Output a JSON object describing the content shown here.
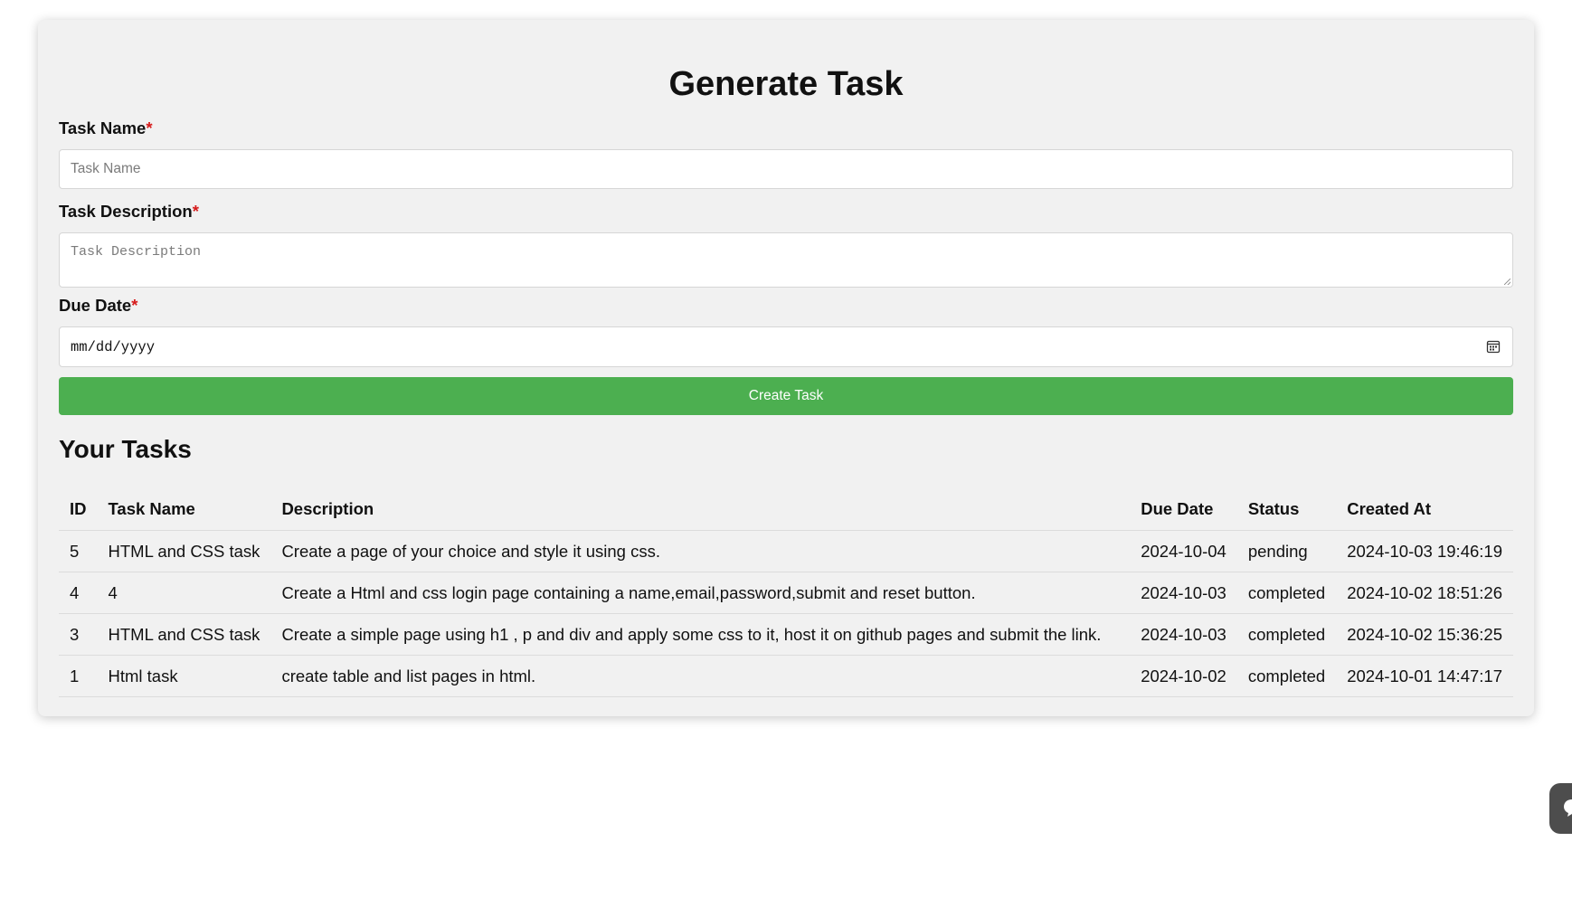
{
  "form": {
    "title": "Generate Task",
    "task_name_label": "Task Name",
    "task_name_placeholder": "Task Name",
    "task_description_label": "Task Description",
    "task_description_placeholder": "Task Description",
    "due_date_label": "Due Date",
    "due_date_placeholder": "mm/dd/yyyy",
    "required_marker": "*",
    "submit_label": "Create Task"
  },
  "tasks": {
    "heading": "Your Tasks",
    "columns": [
      "ID",
      "Task Name",
      "Description",
      "Due Date",
      "Status",
      "Created At"
    ],
    "rows": [
      [
        "5",
        "HTML and CSS task",
        "Create a page of your choice and style it using css.",
        "2024-10-04",
        "pending",
        "2024-10-03 19:46:19"
      ],
      [
        "4",
        "4",
        "Create a Html and css login page containing a name,email,password,submit and reset button.",
        "2024-10-03",
        "completed",
        "2024-10-02 18:51:26"
      ],
      [
        "3",
        "HTML and CSS task",
        "Create a simple page using h1 , p and div and apply some css to it, host it on github pages and submit the link.",
        "2024-10-03",
        "completed",
        "2024-10-02 15:36:25"
      ],
      [
        "1",
        "Html task",
        "create table and list pages in html.",
        "2024-10-02",
        "completed",
        "2024-10-01 14:47:17"
      ]
    ]
  },
  "colors": {
    "button_bg": "#4caf50",
    "required": "#d61a1a",
    "card_bg": "#f1f1f1"
  },
  "icons": {
    "date_picker": "calendar-icon",
    "floating_widget": "chat-bubble-icon"
  }
}
